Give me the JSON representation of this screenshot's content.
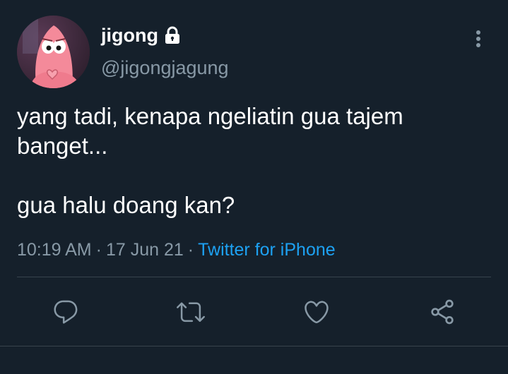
{
  "tweet": {
    "author": {
      "display_name": "jigong",
      "handle": "@jigongjagung",
      "protected": true,
      "avatar": "pink-cartoon-character-avatar"
    },
    "text": "yang tadi, kenapa ngeliatin gua tajem\nbanget...\n\ngua halu doang kan?",
    "time": "10:19 AM",
    "separator": "·",
    "date": "17 Jun 21",
    "source": "Twitter for iPhone"
  },
  "actions": [
    {
      "name": "reply",
      "icon": "reply-icon"
    },
    {
      "name": "retweet",
      "icon": "retweet-icon"
    },
    {
      "name": "like",
      "icon": "heart-icon"
    },
    {
      "name": "share",
      "icon": "share-icon"
    }
  ],
  "colors": {
    "background": "#15202b",
    "primary_text": "#ffffff",
    "secondary_text": "#8899a6",
    "link": "#1da1f2",
    "divider": "#38444d"
  }
}
